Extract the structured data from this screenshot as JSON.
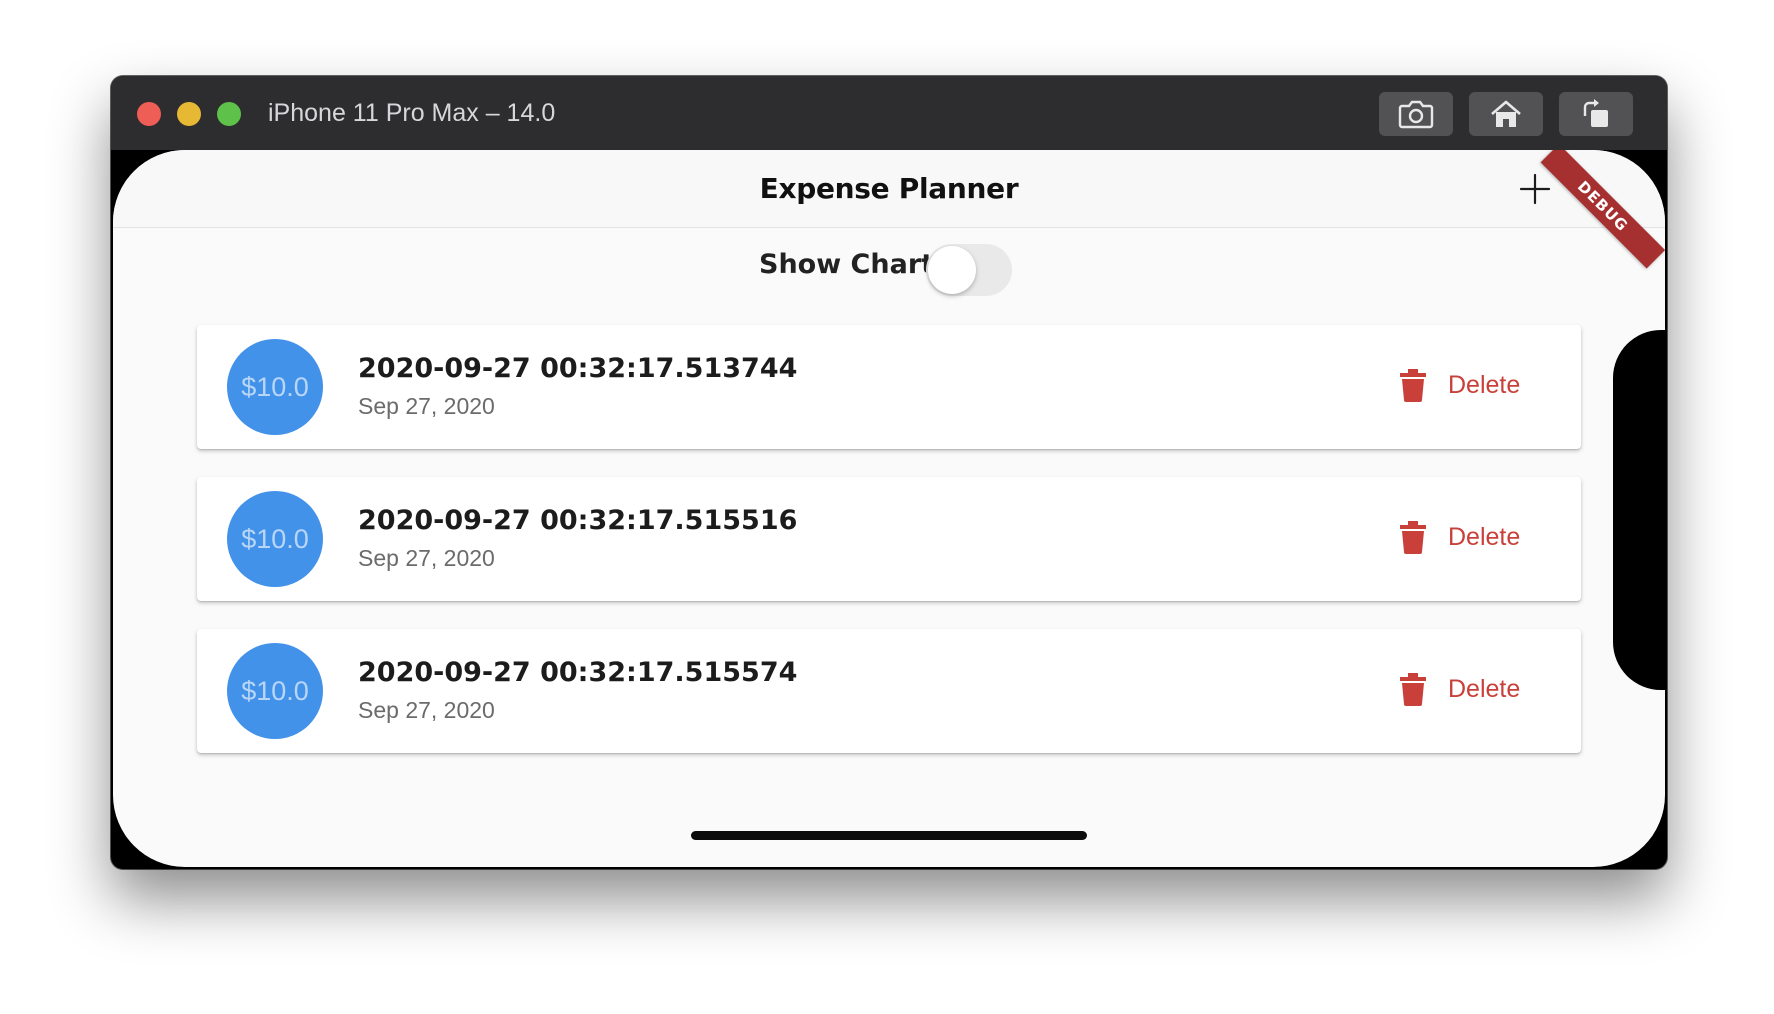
{
  "window": {
    "title": "iPhone 11 Pro Max – 14.0",
    "toolbar": {
      "screenshot_icon": "camera-icon",
      "home_icon": "home-icon",
      "rotate_icon": "rotate-icon"
    }
  },
  "app": {
    "title": "Expense Planner",
    "add_icon": "plus-icon",
    "debug_banner": "DEBUG",
    "show_chart_label": "Show Chart",
    "show_chart_on": false,
    "accent_color": "#4392ea",
    "delete_color": "#c9403a"
  },
  "transactions": [
    {
      "amount": "$10.0",
      "title": "2020-09-27 00:32:17.513744",
      "date": "Sep 27, 2020",
      "delete_label": "Delete"
    },
    {
      "amount": "$10.0",
      "title": "2020-09-27 00:32:17.515516",
      "date": "Sep 27, 2020",
      "delete_label": "Delete"
    },
    {
      "amount": "$10.0",
      "title": "2020-09-27 00:32:17.515574",
      "date": "Sep 27, 2020",
      "delete_label": "Delete"
    }
  ]
}
